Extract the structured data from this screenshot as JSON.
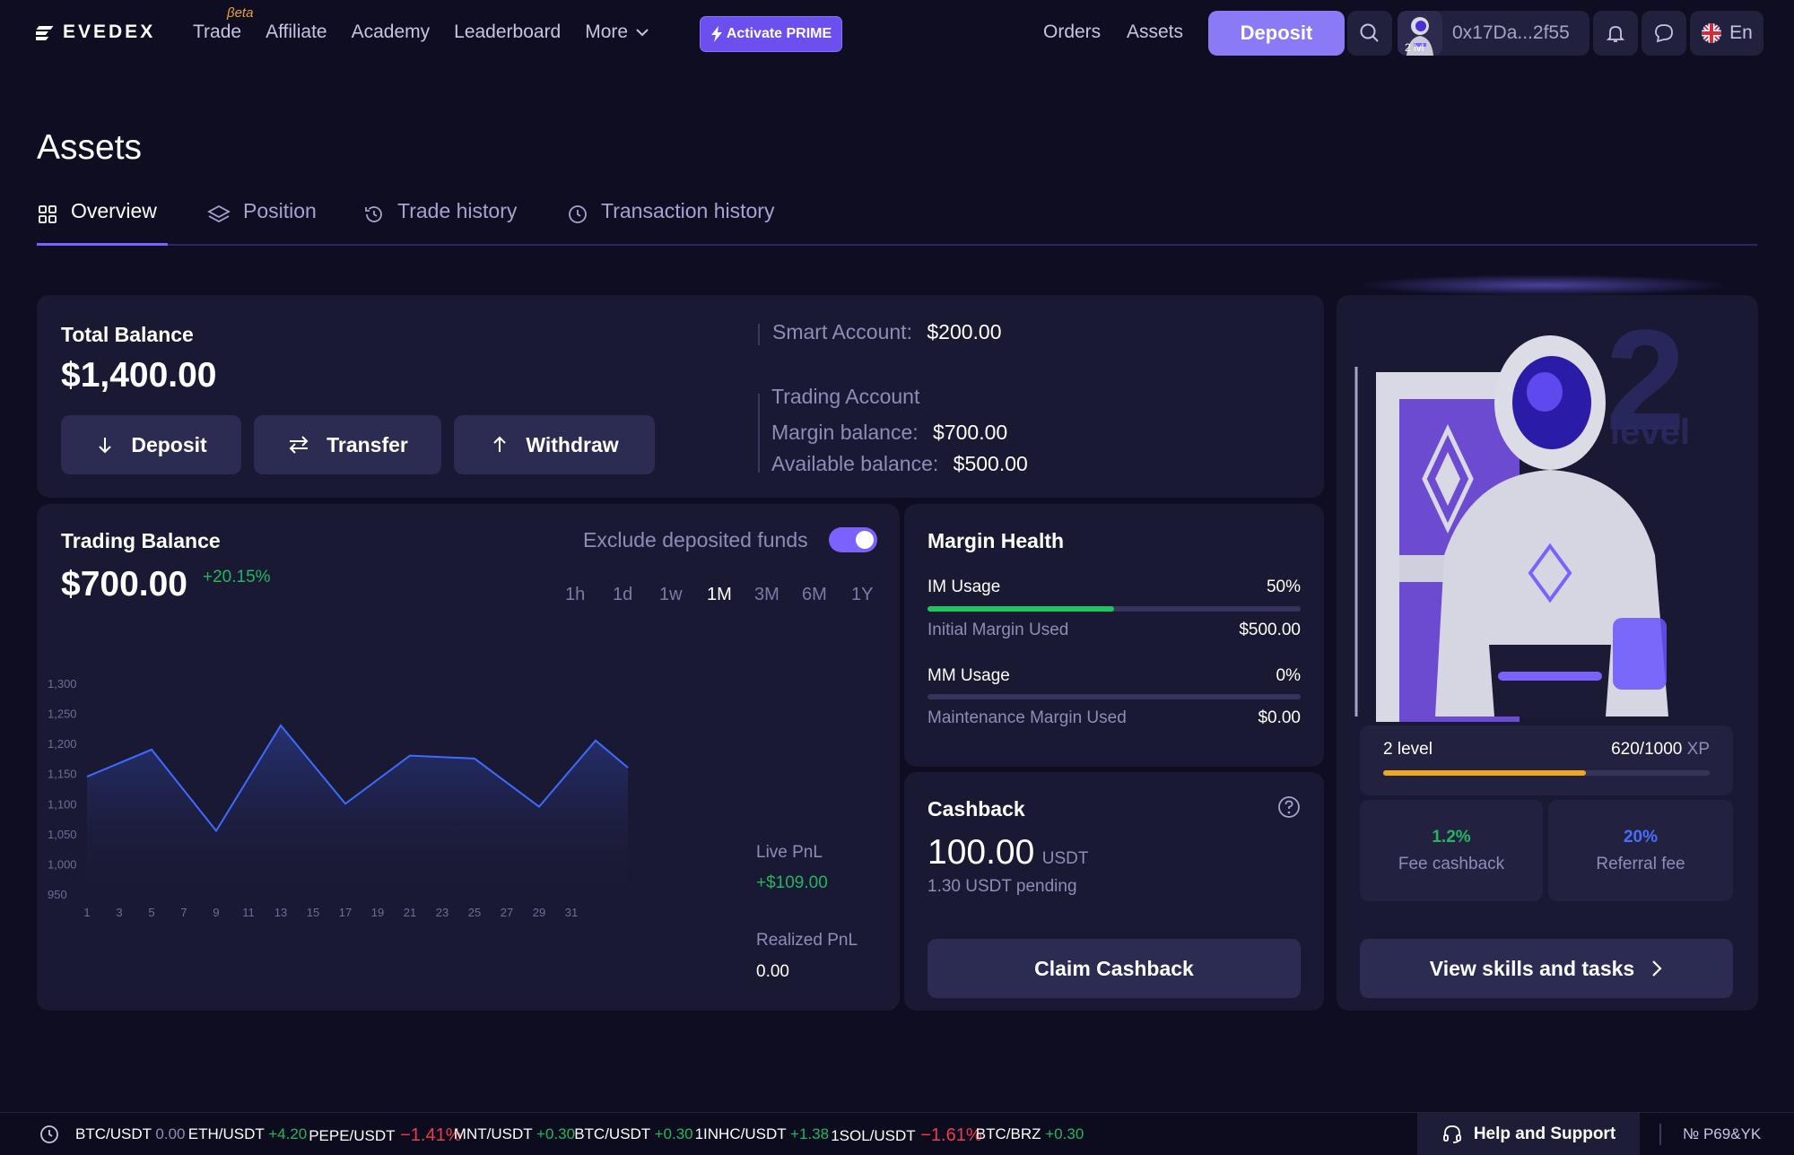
{
  "nav": {
    "logo_text": "EVEDEX",
    "links": [
      "Trade",
      "Affiliate",
      "Academy",
      "Leaderboard",
      "More"
    ],
    "beta_label": "βeta",
    "prime_label": "Activate PRIME",
    "orders_label": "Orders",
    "assets_label": "Assets",
    "deposit_label": "Deposit",
    "wallet_address": "0x17Da...2f55",
    "avatar_level": "2 lvl",
    "language": "En"
  },
  "page": {
    "title": "Assets",
    "tabs": [
      "Overview",
      "Position",
      "Trade history",
      "Transaction history"
    ],
    "active_tab": "Overview"
  },
  "balance": {
    "title": "Total Balance",
    "value": "$1,400.00",
    "buttons": [
      "Deposit",
      "Transfer",
      "Withdraw"
    ],
    "smart_account_label": "Smart Account:",
    "smart_account_value": "$200.00",
    "trading_account_label": "Trading Account",
    "margin_balance_label": "Margin balance:",
    "margin_balance_value": "$700.00",
    "available_balance_label": "Available balance:",
    "available_balance_value": "$500.00"
  },
  "trading": {
    "title": "Trading Balance",
    "value": "$700.00",
    "change": "+20.15%",
    "exclude_label": "Exclude deposited funds",
    "exclude_on": true,
    "timeframes": [
      "1h",
      "1d",
      "1w",
      "1M",
      "3M",
      "6M",
      "1Y"
    ],
    "active_timeframe": "1M",
    "live_pnl_label": "Live PnL",
    "live_pnl_value": "+$109.00",
    "realized_pnl_label": "Realized PnL",
    "realized_pnl_value": "0.00"
  },
  "chart_data": {
    "type": "area",
    "x": [
      1,
      3,
      5,
      7,
      9,
      11,
      13,
      15,
      17,
      19,
      21,
      23,
      25,
      27,
      29,
      31
    ],
    "xticks": [
      "1",
      "3",
      "5",
      "7",
      "9",
      "11",
      "13",
      "15",
      "17",
      "19",
      "21",
      "23",
      "25",
      "27",
      "29",
      "31"
    ],
    "yticks": [
      "950",
      "1,000",
      "1,050",
      "1,100",
      "1,150",
      "1,200",
      "1,250",
      "1,300"
    ],
    "ylim": [
      950,
      1300
    ],
    "points": [
      [
        1,
        1145
      ],
      [
        5,
        1190
      ],
      [
        9,
        1055
      ],
      [
        13,
        1230
      ],
      [
        17,
        1100
      ],
      [
        21,
        1180
      ],
      [
        25,
        1175
      ],
      [
        29,
        1095
      ],
      [
        32.5,
        1205
      ],
      [
        34.5,
        1160
      ]
    ],
    "line_color": "#3e6bff",
    "grid": false
  },
  "margin": {
    "title": "Margin Health",
    "im_label": "IM Usage",
    "im_value": "50%",
    "im_fraction": 0.5,
    "im_used_label": "Initial Margin Used",
    "im_used_value": "$500.00",
    "mm_label": "MM Usage",
    "mm_value": "0%",
    "mm_fraction": 0,
    "mm_used_label": "Maintenance Margin Used",
    "mm_used_value": "$0.00",
    "bar_color": "#22c35e"
  },
  "cashback": {
    "title": "Cashback",
    "value": "100.00",
    "unit": "USDT",
    "pending": "1.30 USDT pending",
    "claim_label": "Claim Cashback"
  },
  "level": {
    "big_number": "2",
    "big_word": "level",
    "label": "2 level",
    "xp_current": "620/1000",
    "xp_unit": "XP",
    "xp_fraction": 0.62,
    "xp_color": "#f2a61b",
    "fee_value": "1.2%",
    "fee_label": "Fee cashback",
    "referral_value": "20%",
    "referral_label": "Referral fee",
    "skills_label": "View skills and tasks"
  },
  "ticker": [
    {
      "pair": "BTC/USDT",
      "change": "0.00",
      "dir": "flat"
    },
    {
      "pair": "ETH/USDT",
      "change": "+4.20",
      "dir": "up"
    },
    {
      "pair": "PEPE/USDT",
      "change": "−1.41%",
      "dir": "down"
    },
    {
      "pair": "MNT/USDT",
      "change": "+0.30",
      "dir": "up"
    },
    {
      "pair": "BTC/USDT",
      "change": "+0.30",
      "dir": "up"
    },
    {
      "pair": "1INHC/USDT",
      "change": "+1.38",
      "dir": "up"
    },
    {
      "pair": "1SOL/USDT",
      "change": "−1.61%",
      "dir": "down"
    },
    {
      "pair": "BTC/BRZ",
      "change": "+0.30",
      "dir": "up"
    }
  ],
  "status": {
    "help_label": "Help and Support",
    "build_id": "№ P69&YK"
  }
}
